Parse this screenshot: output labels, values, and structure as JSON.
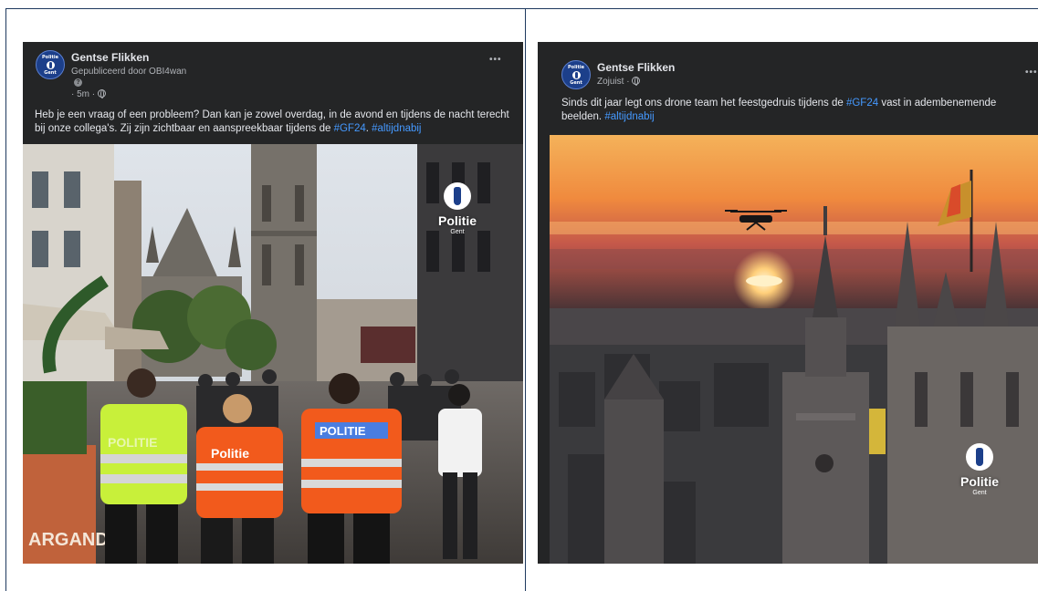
{
  "posts": [
    {
      "page_name": "Gentse Flikken",
      "published_by": "Gepubliceerd door OBI4wan",
      "time": "· 5m ·",
      "body": "Heb je een vraag of een probleem? Dan kan je zowel overdag, in de avond en tijdens de nacht terecht bij onze collega's. Zij zijn zichtbaar en aanspreekbaar tijdens de ",
      "hashtags": [
        "#GF24",
        "#altijdnabij"
      ],
      "more_label": "•••",
      "photo_logo": {
        "word": "Politie",
        "sub": "Gent"
      },
      "vest_labels": [
        "POLITIE",
        "Politie",
        "POLITIE"
      ],
      "sign_text": "ARGAND"
    },
    {
      "page_name": "Gentse Flikken",
      "time": "Zojuist ·",
      "body": "Sinds dit jaar legt ons drone team het feestgedruis tijdens de ",
      "body_mid": " vast in adembenemende beelden. ",
      "hashtags": [
        "#GF24",
        "#altijdnabij"
      ],
      "more_label": "•••",
      "photo_logo": {
        "word": "Politie",
        "sub": "Gent"
      }
    }
  ],
  "avatar": {
    "top": "Politie",
    "bottom": "Gent"
  },
  "colors": {
    "hashtag": "#4599ff",
    "panel": "#242526",
    "frame": "#1f3a5f"
  }
}
